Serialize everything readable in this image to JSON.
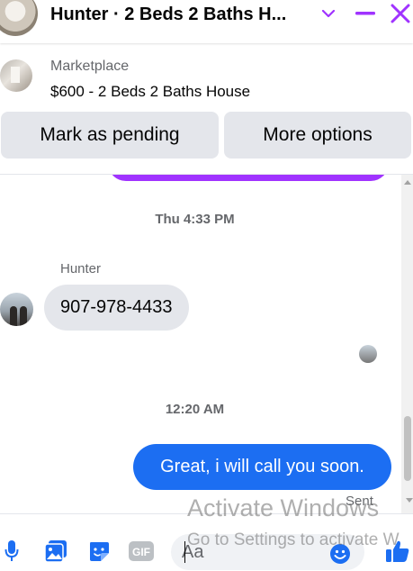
{
  "header": {
    "title": "Hunter · 2 Beds 2 Baths H..."
  },
  "marketplace": {
    "label": "Marketplace",
    "listing": "$600 - 2 Beds 2 Baths House",
    "buttons": {
      "mark_pending": "Mark as pending",
      "more_options": "More options"
    }
  },
  "messages": {
    "timestamp_1": "Thu 4:33 PM",
    "sender_name": "Hunter",
    "incoming_text": "907-978-4433",
    "timestamp_2": "12:20 AM",
    "outgoing_text": "Great, i will call you soon.",
    "status": "Sent"
  },
  "composer": {
    "placeholder": "Aa"
  },
  "watermark": {
    "title": "Activate Windows",
    "subtitle": "Go to Settings to activate W"
  },
  "colors": {
    "accent": "#a033ff",
    "brand_blue": "#1c6ef2",
    "bubble_gray": "#e4e6eb",
    "muted_text": "#65676b"
  },
  "icons": [
    "chevron-down-icon",
    "minimize-icon",
    "close-icon",
    "microphone-icon",
    "photo-icon",
    "sticker-icon",
    "gif-icon",
    "emoji-icon",
    "like-icon"
  ]
}
